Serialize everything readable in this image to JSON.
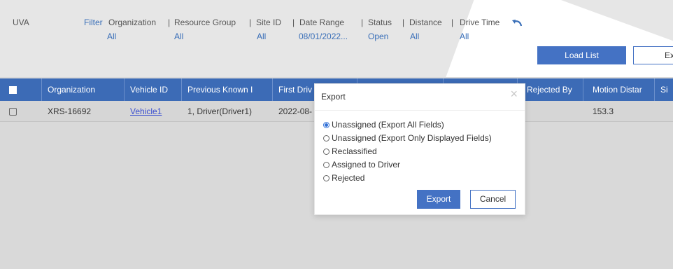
{
  "filterbar": {
    "app": "UVA",
    "filter_link": "Filter",
    "filters": [
      {
        "label": "Organization",
        "value": "All"
      },
      {
        "label": "Resource Group",
        "value": "All"
      },
      {
        "label": "Site ID",
        "value": "All"
      },
      {
        "label": "Date Range",
        "value": "08/01/2022..."
      },
      {
        "label": "Status",
        "value": "Open"
      },
      {
        "label": "Distance",
        "value": "All"
      },
      {
        "label": "Drive Time",
        "value": "All"
      }
    ],
    "separator": "|",
    "undo_icon": "undo-arrow-icon",
    "load_list": "Load List",
    "export_partial": "Ex"
  },
  "table": {
    "headers": [
      "Organization",
      "Vehicle ID",
      "Previous Known I",
      "First Driv",
      "",
      "",
      "Rejected By",
      "Motion Distar",
      "Si"
    ],
    "rows": [
      {
        "organization": "XRS-16692",
        "vehicle": "Vehicle1",
        "previous": "1, Driver(Driver1)",
        "first": "2022-08-",
        "motion": "153.3"
      }
    ]
  },
  "modal": {
    "title": "Export",
    "close": "×",
    "options": [
      "Unassigned (Export All Fields)",
      "Unassigned (Export Only Displayed Fields)",
      "Reclassified",
      "Assigned to Driver",
      "Rejected"
    ],
    "selected_index": 0,
    "export": "Export",
    "cancel": "Cancel"
  },
  "colors": {
    "accent": "#4472c4",
    "header": "#3c6bb6",
    "link": "#3a6fb8"
  }
}
